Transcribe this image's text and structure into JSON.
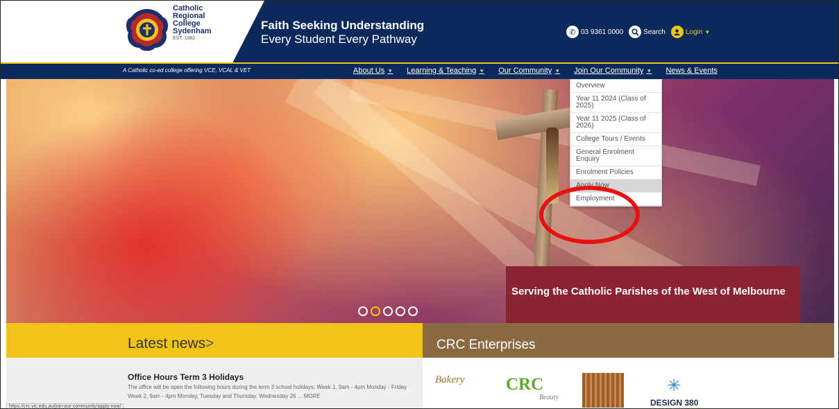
{
  "header": {
    "logo_lines": [
      "Catholic",
      "Regional",
      "College",
      "Sydenham"
    ],
    "logo_est": "EST. 1982",
    "tagline_main": "Faith Seeking Understanding",
    "tagline_sub": "Every Student Every Pathway",
    "phone": "03 9361 0000",
    "search_label": "Search",
    "login_label": "Login"
  },
  "nav": {
    "tagline": "A Catholic co-ed college offering VCE, VCAL & VET",
    "items": [
      {
        "label": "About Us",
        "caret": true
      },
      {
        "label": "Learning & Teaching",
        "caret": true
      },
      {
        "label": "Our Community",
        "caret": true
      },
      {
        "label": "Join Our Community",
        "caret": true
      },
      {
        "label": "News & Events",
        "caret": false
      }
    ]
  },
  "dropdown": {
    "items": [
      "Overview",
      "Year 11 2024 (Class of 2025)",
      "Year 11 2025 (Class of 2026)",
      "College Tours / Events",
      "General Enrolment Enquiry",
      "Enrolment Policies",
      "Apply Now",
      "Employment"
    ],
    "highlighted_index": 6
  },
  "hero": {
    "banner_text": "Serving the Catholic Parishes of the West of Melbourne",
    "slide_count": 5,
    "active_slide": 1
  },
  "news": {
    "section_title": "Latest news",
    "chevron": ">",
    "item_title": "Office Hours Term 3 Holidays",
    "item_body": "The office will be open the following hours during the term 3 school holidays: Week 1, 9am - 4pm Monday - Friday Week 2, 9am - 4pm Monday, Tuesday and Thursday. Wednesday 26 ... MORE"
  },
  "enterprises": {
    "section_title": "CRC Enterprises",
    "logos": {
      "bakery": "Bakery",
      "crc": "CRC",
      "crc_sub": "Beauty",
      "design": "DESIGN 380"
    }
  },
  "status_bar": {
    "url": "https://crc.vic.edu.au/join-our-community/apply-now/"
  },
  "colors": {
    "navy": "#0b2a5b",
    "gold": "#f2c319",
    "maroon": "#8a2332",
    "brown": "#8b6a43",
    "highlight_circle": "#e81010"
  }
}
